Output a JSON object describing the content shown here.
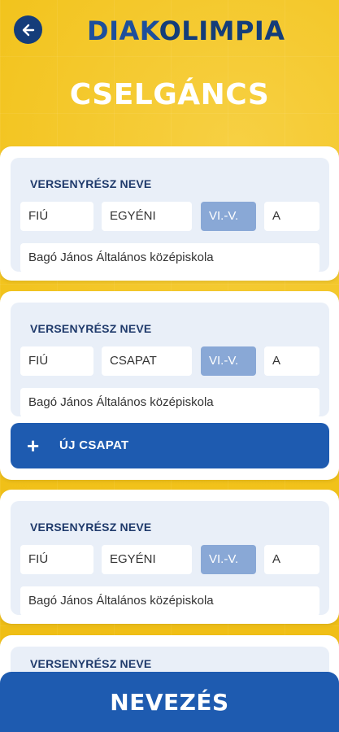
{
  "header": {
    "logo_part1": "DIAK",
    "logo_part2": "OLIMPIA",
    "back_icon": "arrow-left-icon"
  },
  "page": {
    "title": "CSELGÁNCS"
  },
  "entries": [
    {
      "label": "VERSENYRÉSZ NEVE",
      "gender": "FIÚ",
      "type": "EGYÉNI",
      "category": "VI.-V.",
      "level": "A",
      "school": "Bagó János Általános középiskola"
    },
    {
      "label": "VERSENYRÉSZ NEVE",
      "gender": "FIÚ",
      "type": "CSAPAT",
      "category": "VI.-V.",
      "level": "A",
      "school": "Bagó János Általános középiskola"
    },
    {
      "label": "VERSENYRÉSZ NEVE",
      "gender": "FIÚ",
      "type": "EGYÉNI",
      "category": "VI.-V.",
      "level": "A",
      "school": "Bagó János Általános középiskola"
    },
    {
      "label": "VERSENYRÉSZ NEVE"
    }
  ],
  "new_team": {
    "plus": "+",
    "label": "ÚJ CSAPAT"
  },
  "submit": {
    "label": "NEVEZÉS"
  },
  "colors": {
    "background": "#f2c31c",
    "primary": "#1e5bb0",
    "navy": "#143d7a",
    "selected_field": "#89a8d6",
    "panel": "#e9eff8"
  }
}
